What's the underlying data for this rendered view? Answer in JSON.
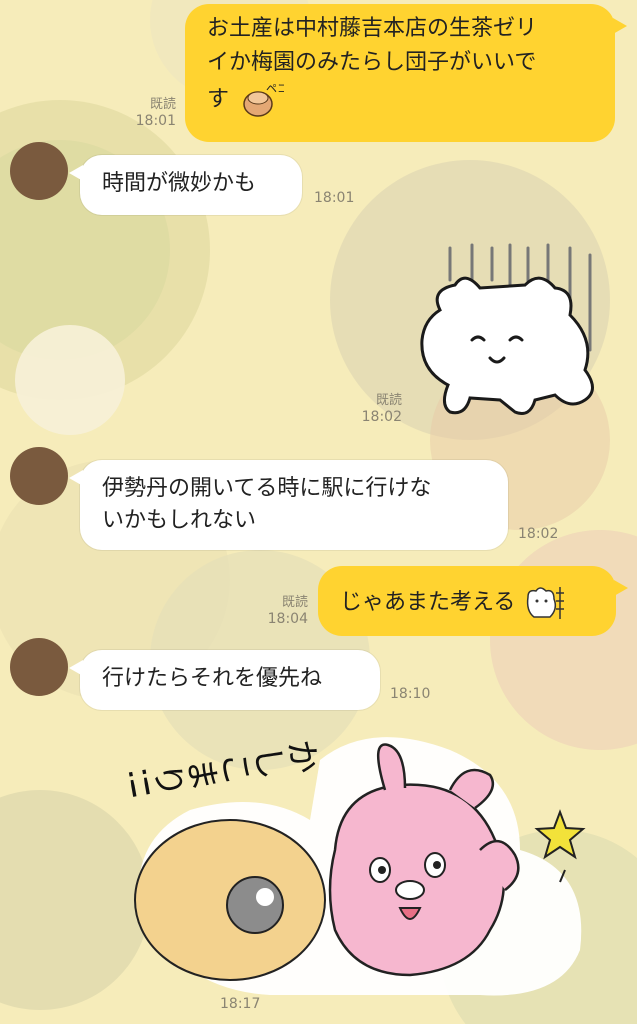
{
  "messages": [
    {
      "id": "m1",
      "side": "outgoing",
      "text_line1": "お土産は中村藤吉本店の生茶ゼリ",
      "text_line2": "イか梅園のみたらし団子がいいで",
      "text_line3": "す",
      "emoji": "bowing-sticker-emoji",
      "read_label": "既読",
      "time": "18:01"
    },
    {
      "id": "m2",
      "side": "incoming",
      "text": "時間が微妙かも",
      "time": "18:01"
    },
    {
      "id": "m3",
      "side": "outgoing",
      "type": "sticker",
      "sticker": "smiling-bear-gloom-sticker",
      "read_label": "既読",
      "time": "18:02"
    },
    {
      "id": "m4",
      "side": "incoming",
      "text_line1": "伊勢丹の開いてる時に駅に行けな",
      "text_line2": "いかもしれない",
      "time": "18:02"
    },
    {
      "id": "m5",
      "side": "outgoing",
      "text": "じゃあまた考える",
      "emoji": "bear-wall-emoji",
      "read_label": "既読",
      "time": "18:04"
    },
    {
      "id": "m6",
      "side": "incoming",
      "text": "行けたらそれを優先ね",
      "time": "18:10"
    },
    {
      "id": "m7",
      "side": "incoming",
      "type": "sticker",
      "sticker": "pink-rabbit-kashikomari-sticker",
      "sticker_text": "かしこまり!!",
      "time": "18:17"
    }
  ],
  "colors": {
    "background": "#f6ecba",
    "outgoing_bubble": "#ffd330",
    "incoming_bubble": "#ffffff",
    "avatar": "#7a5a3e"
  }
}
